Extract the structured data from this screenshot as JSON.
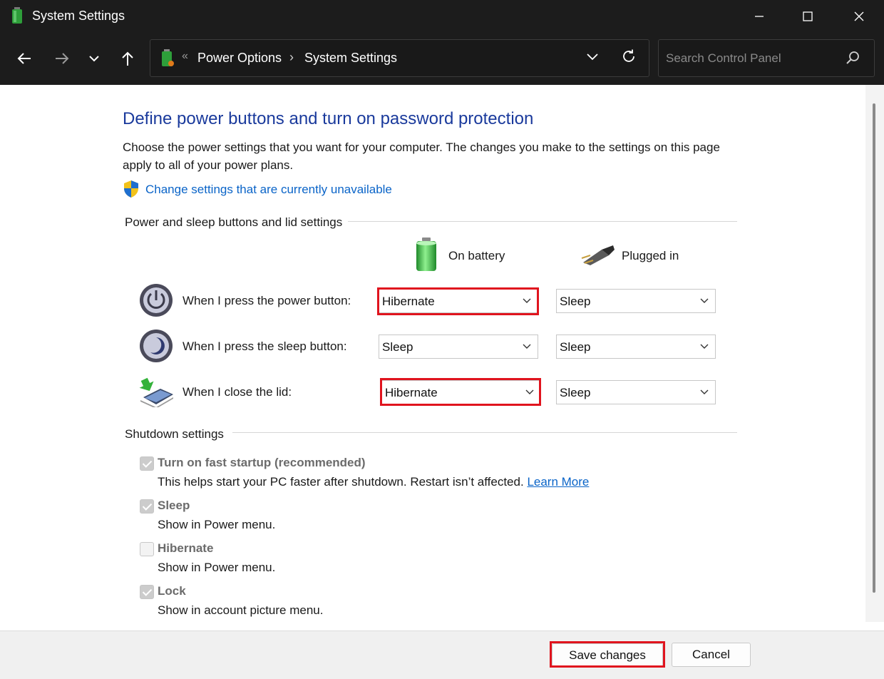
{
  "window": {
    "title": "System Settings"
  },
  "address": {
    "separator": "«",
    "crumbs": [
      "Power Options",
      "System Settings"
    ],
    "crumb_sep": "›"
  },
  "search": {
    "placeholder": "Search Control Panel"
  },
  "page": {
    "title": "Define power buttons and turn on password protection",
    "description": "Choose the power settings that you want for your computer. The changes you make to the settings on this page apply to all of your power plans.",
    "change_link": "Change settings that are currently unavailable"
  },
  "power_section": {
    "label": "Power and sleep buttons and lid settings",
    "col_battery": "On battery",
    "col_plugged": "Plugged in",
    "rows": [
      {
        "label": "When I press the power button:",
        "battery": "Hibernate",
        "plugged": "Sleep"
      },
      {
        "label": "When I press the sleep button:",
        "battery": "Sleep",
        "plugged": "Sleep"
      },
      {
        "label": "When I close the lid:",
        "battery": "Hibernate",
        "plugged": "Sleep"
      }
    ]
  },
  "shutdown_section": {
    "label": "Shutdown settings",
    "options": [
      {
        "title": "Turn on fast startup (recommended)",
        "desc": "This helps start your PC faster after shutdown. Restart isn’t affected.",
        "link": "Learn More",
        "checked": true
      },
      {
        "title": "Sleep",
        "desc": "Show in Power menu.",
        "checked": true
      },
      {
        "title": "Hibernate",
        "desc": "Show in Power menu.",
        "checked": false
      },
      {
        "title": "Lock",
        "desc": "Show in account picture menu.",
        "checked": true
      }
    ]
  },
  "footer": {
    "save_label": "Save changes",
    "cancel_label": "Cancel"
  },
  "colors": {
    "title_blue": "#1a3a9c",
    "link_blue": "#0a64c8",
    "highlight_red": "#e0141e",
    "chrome_dark": "#1c1c1c"
  }
}
